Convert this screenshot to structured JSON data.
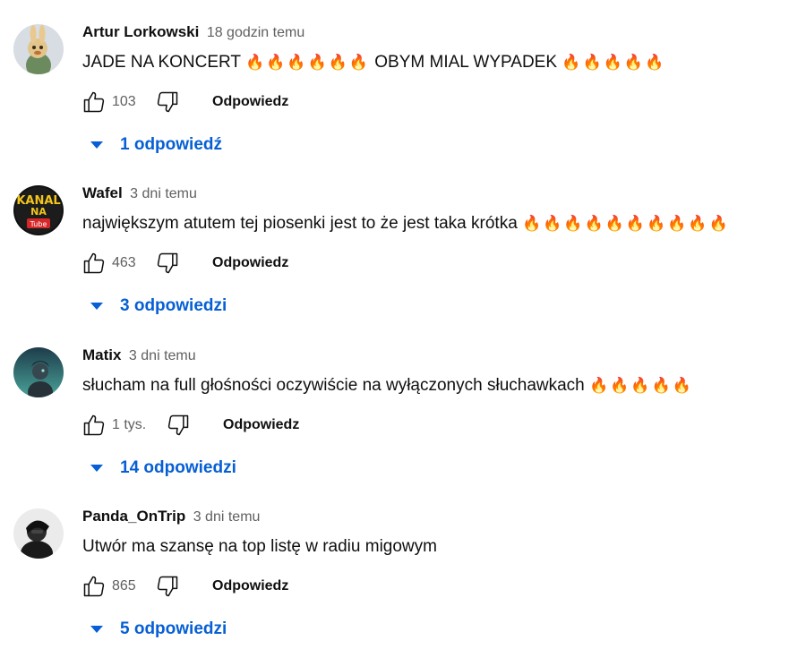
{
  "comments": [
    {
      "author": "Artur Lorkowski",
      "time": "18 godzin temu",
      "text": "JADE NA KONCERT",
      "fire_before": "🔥🔥🔥🔥🔥🔥",
      "text_after": "OBYM MIAL WYPADEK",
      "fire_after": "🔥🔥🔥🔥🔥",
      "likes": "103",
      "reply_label": "Odpowiedz",
      "replies_label": "1 odpowiedź"
    },
    {
      "author": "Wafel",
      "time": "3 dni temu",
      "text": "największym atutem tej piosenki jest to że jest taka krótka",
      "fire_after": "🔥🔥🔥🔥🔥🔥🔥🔥🔥🔥",
      "likes": "463",
      "reply_label": "Odpowiedz",
      "replies_label": "3 odpowiedzi",
      "avatar_text_1": "KANAL",
      "avatar_text_2": "NA",
      "avatar_text_3": "Tube"
    },
    {
      "author": "Matix",
      "time": "3 dni temu",
      "text": "słucham na full głośności oczywiście na wyłączonych słuchawkach",
      "fire_after": "🔥🔥🔥🔥🔥",
      "likes": "1 tys.",
      "reply_label": "Odpowiedz",
      "replies_label": "14 odpowiedzi"
    },
    {
      "author": "Panda_OnTrip",
      "time": "3 dni temu",
      "text": "Utwór ma szansę na top listę w radiu migowym",
      "likes": "865",
      "reply_label": "Odpowiedz",
      "replies_label": "5 odpowiedzi"
    }
  ],
  "icons": {
    "like": "thumbs-up-icon",
    "dislike": "thumbs-down-icon",
    "expand": "caret-down-icon"
  },
  "colors": {
    "link_blue": "#065fd4",
    "secondary_text": "#606060",
    "primary_text": "#0f0f0f"
  }
}
